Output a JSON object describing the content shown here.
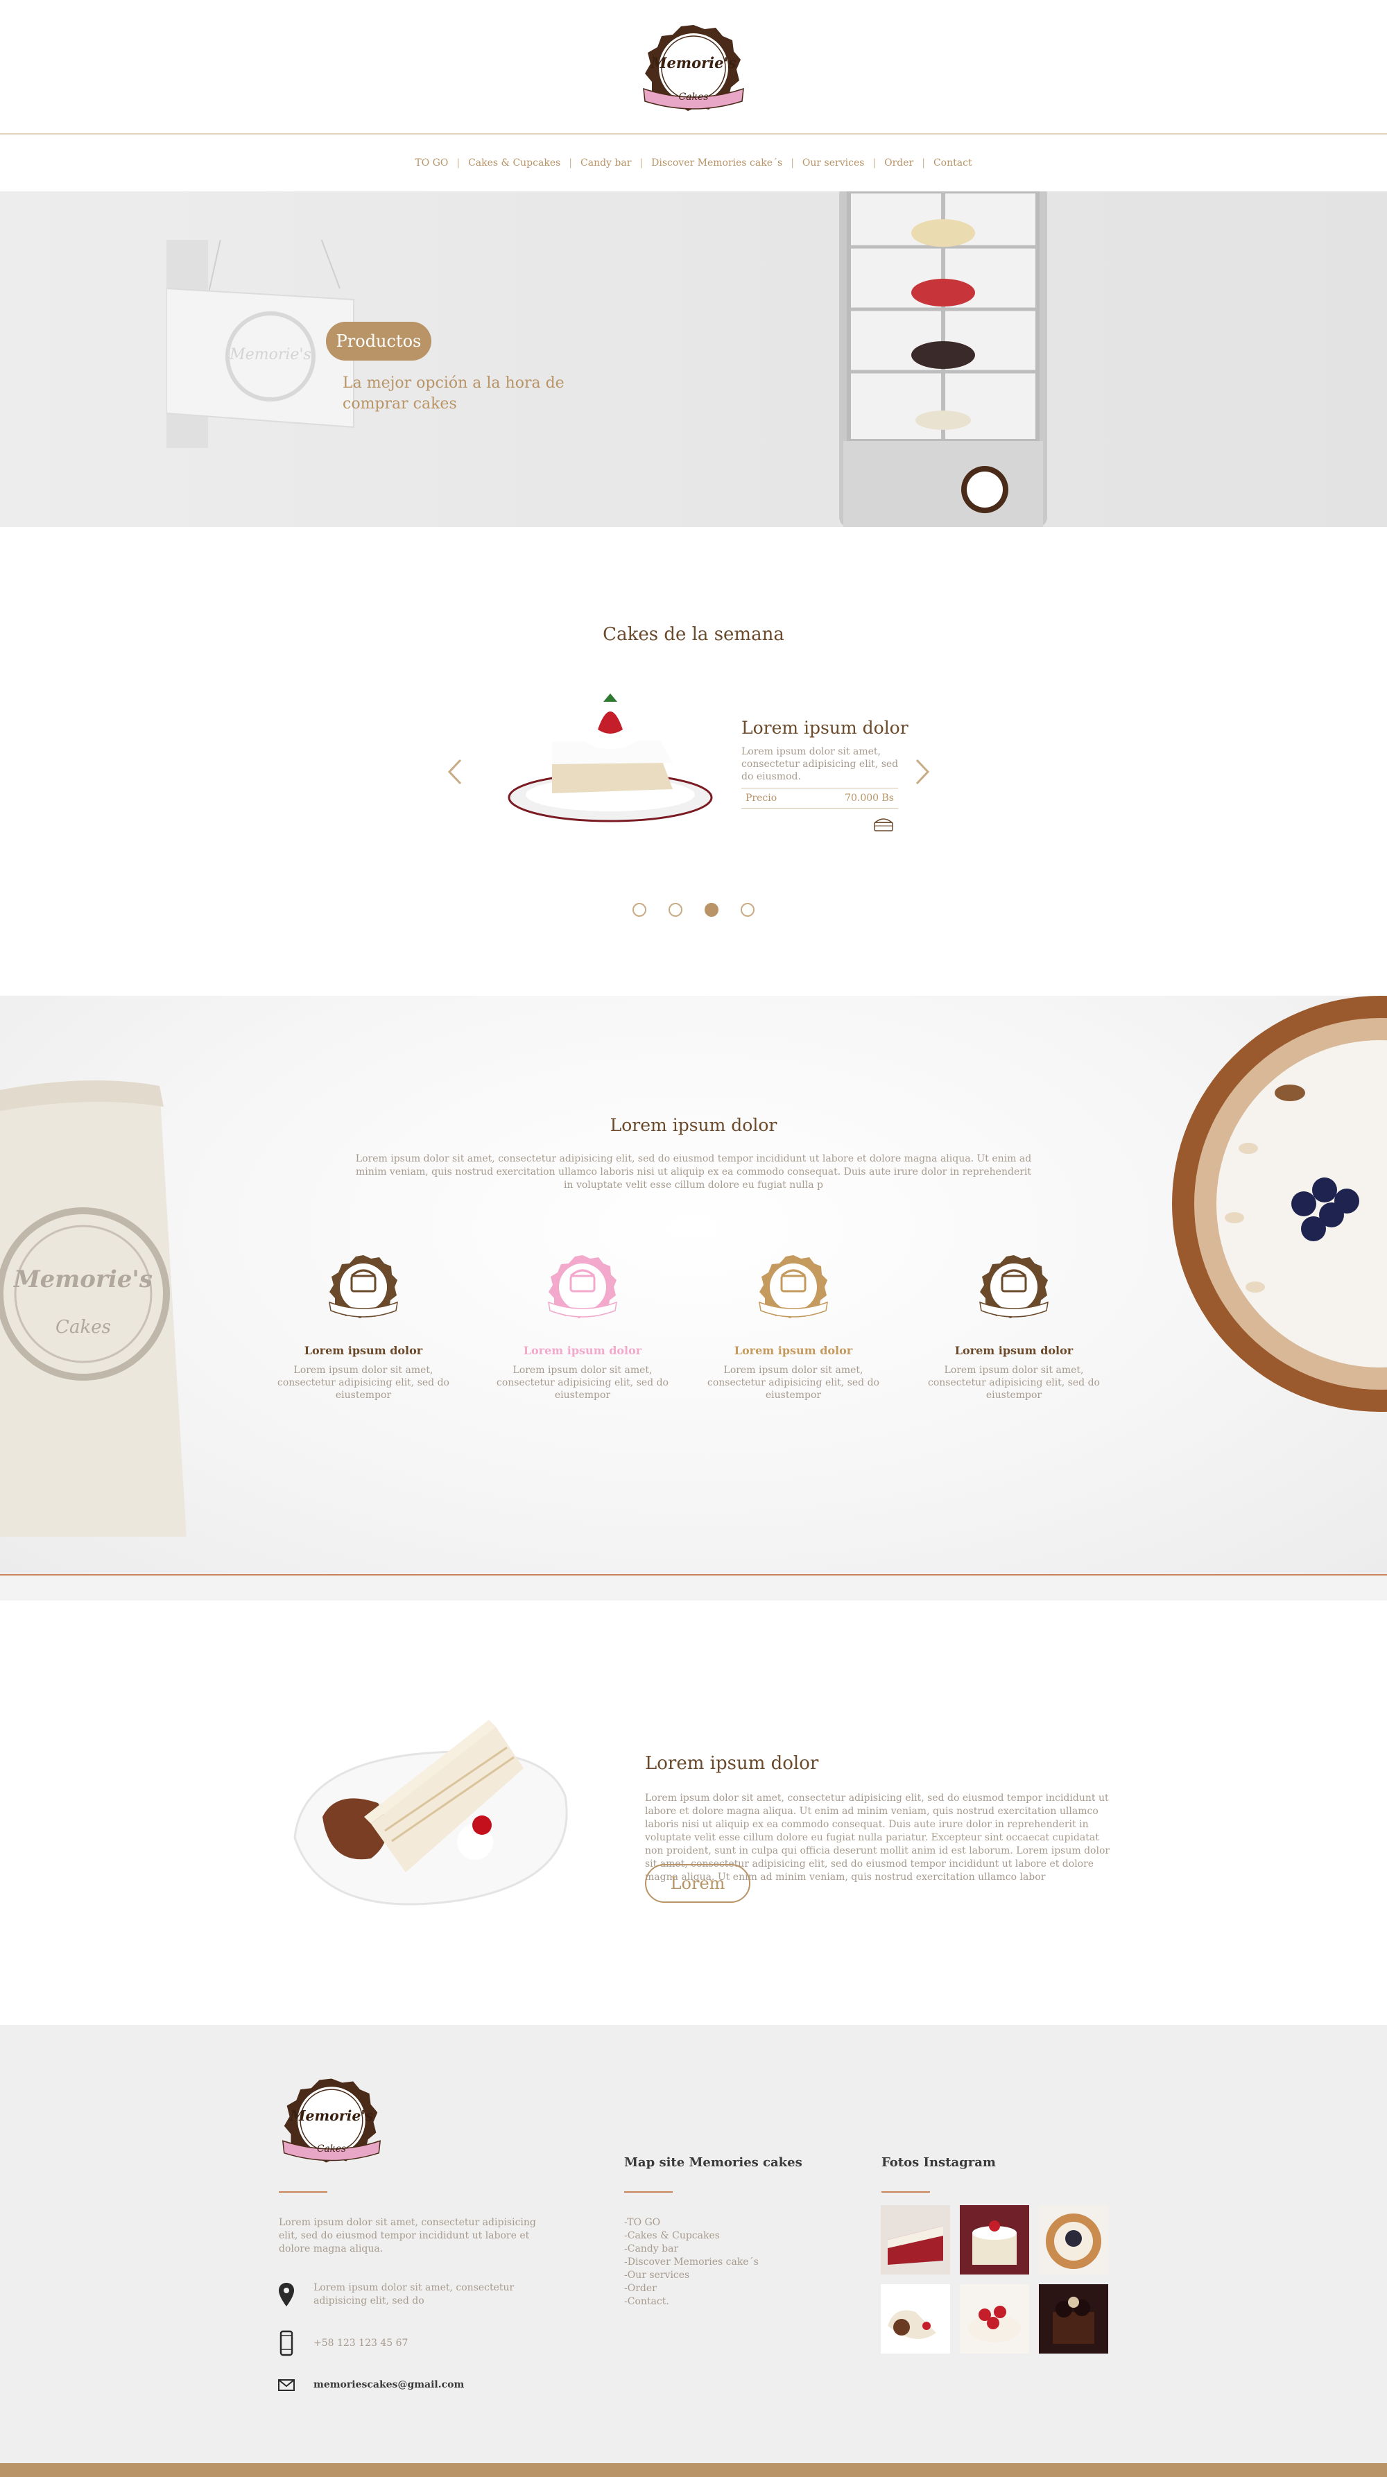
{
  "brand": {
    "logo_line1": "Memorie's",
    "logo_line2": "Cakes"
  },
  "nav": {
    "items": [
      "TO GO",
      "Cakes & Cupcakes",
      "Candy bar",
      "Discover Memories cake´s",
      "Our services",
      "Order",
      "Contact"
    ]
  },
  "hero": {
    "button_label": "Productos",
    "subtitle": "La mejor opción a la hora de comprar cakes"
  },
  "weekly": {
    "title": "Cakes de la semana",
    "product_title": "Lorem ipsum dolor",
    "product_desc": "Lorem ipsum dolor sit amet, consectetur adipisicing elit, sed do eiusmod.",
    "price_label": "Precio",
    "price_value": "70.000 Bs",
    "active_slide_index": 2,
    "slide_count": 4
  },
  "features": {
    "title": "Lorem ipsum dolor",
    "text": "Lorem ipsum dolor sit amet, consectetur adipisicing elit, sed do eiusmod tempor incididunt ut labore et dolore magna aliqua. Ut enim ad minim veniam, quis nostrud exercitation ullamco laboris nisi ut aliquip ex ea commodo consequat. Duis aute irure dolor in reprehenderit in voluptate velit esse cillum dolore eu fugiat nulla p",
    "items": [
      {
        "title": "Lorem ipsum dolor",
        "text": "Lorem ipsum dolor sit amet, consectetur adipisicing elit, sed do eiustempor",
        "color": "#6b4a2b"
      },
      {
        "title": "Lorem ipsum dolor",
        "text": "Lorem ipsum dolor sit amet, consectetur adipisicing elit, sed do eiustempor",
        "color": "#f2a9cc"
      },
      {
        "title": "Lorem ipsum dolor",
        "text": "Lorem ipsum dolor sit amet, consectetur adipisicing elit, sed do eiustempor",
        "color": "#c59a5e"
      },
      {
        "title": "Lorem ipsum dolor",
        "text": "Lorem ipsum dolor sit amet, consectetur adipisicing elit, sed do eiustempor",
        "color": "#6b4a2b"
      }
    ]
  },
  "promo": {
    "title": "Lorem ipsum dolor",
    "text": "Lorem ipsum dolor sit amet, consectetur adipisicing elit, sed do eiusmod tempor incididunt ut labore et dolore magna aliqua. Ut enim ad minim veniam, quis nostrud exercitation ullamco laboris nisi ut aliquip ex ea commodo consequat. Duis aute irure dolor in reprehenderit in voluptate velit esse cillum dolore eu fugiat nulla pariatur. Excepteur sint occaecat cupidatat non proident, sunt in culpa qui officia deserunt mollit anim id est laborum. Lorem ipsum dolor sit amet, consectetur adipisicing elit, sed do eiusmod tempor incididunt ut labore et dolore magna aliqua. Ut enim ad minim veniam, quis nostrud exercitation ullamco labor",
    "button_label": "Lorem"
  },
  "footer": {
    "about": "Lorem ipsum dolor sit amet, consectetur adipisicing elit, sed do eiusmod tempor incididunt ut labore et dolore magna aliqua.",
    "address": "Lorem ipsum dolor sit amet, consectetur adipisicing elit, sed do",
    "phone": "+58 123 123 45 67",
    "email": "memoriescakes@gmail.com",
    "map_title": "Map site Memories cakes",
    "map_links": [
      "-TO GO",
      "-Cakes & Cupcakes",
      "-Candy bar",
      "-Discover Memories cake´s",
      "-Our services",
      "-Order",
      "-Contact."
    ],
    "insta_title": "Fotos Instagram"
  },
  "colors": {
    "accent": "#b89466",
    "dark_brown": "#6b4a2b",
    "rule": "#c9855a",
    "muted_text": "#a79b8e"
  }
}
